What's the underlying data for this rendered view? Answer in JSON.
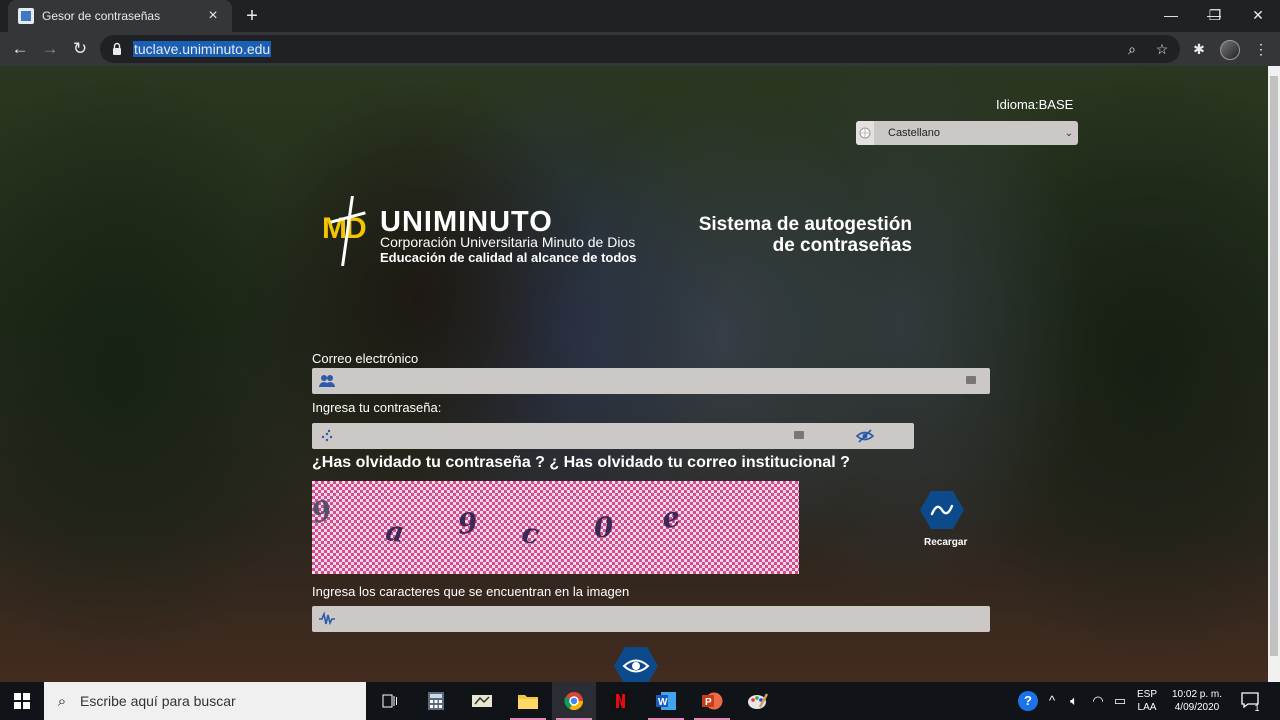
{
  "browser": {
    "tab_title": "Gesor de contraseñas",
    "tab_close": "×",
    "new_tab": "+",
    "url": "tuclave.uniminuto.edu",
    "window_minimize": "—",
    "window_maximize": "❐",
    "window_close": "✕"
  },
  "page": {
    "language_label": "Idioma:BASE",
    "language_value": "Castellano",
    "logo": {
      "name": "UNIMINUTO",
      "monogram": "MD",
      "subtitle1": "Corporación Universitaria Minuto de Dios",
      "subtitle2": "Educación de calidad al alcance de todos"
    },
    "system_title_line1": "Sistema de autogestión",
    "system_title_line2": "de contraseñas",
    "email_label": "Correo electrónico",
    "password_label": "Ingresa tu contraseña:",
    "forgot_text": "¿Has olvidado tu contraseña ? ¿ Has olvidado tu correo institucional ?",
    "captcha_chars": [
      "9",
      "a",
      "9",
      "c",
      "0",
      "e"
    ],
    "reload_label": "Recargar",
    "captcha_label": "Ingresa los caracteres que se encuentran en la imagen"
  },
  "taskbar": {
    "search_placeholder": "Escribe aquí para buscar",
    "lang_top": "ESP",
    "lang_bottom": "LAA",
    "time": "10:02 p. m.",
    "date": "4/09/2020",
    "notifications": "1"
  },
  "colors": {
    "accent_blue": "#0d4a8c",
    "field_bg": "#ccc8c6",
    "captcha_pink": "#d64a8f"
  }
}
